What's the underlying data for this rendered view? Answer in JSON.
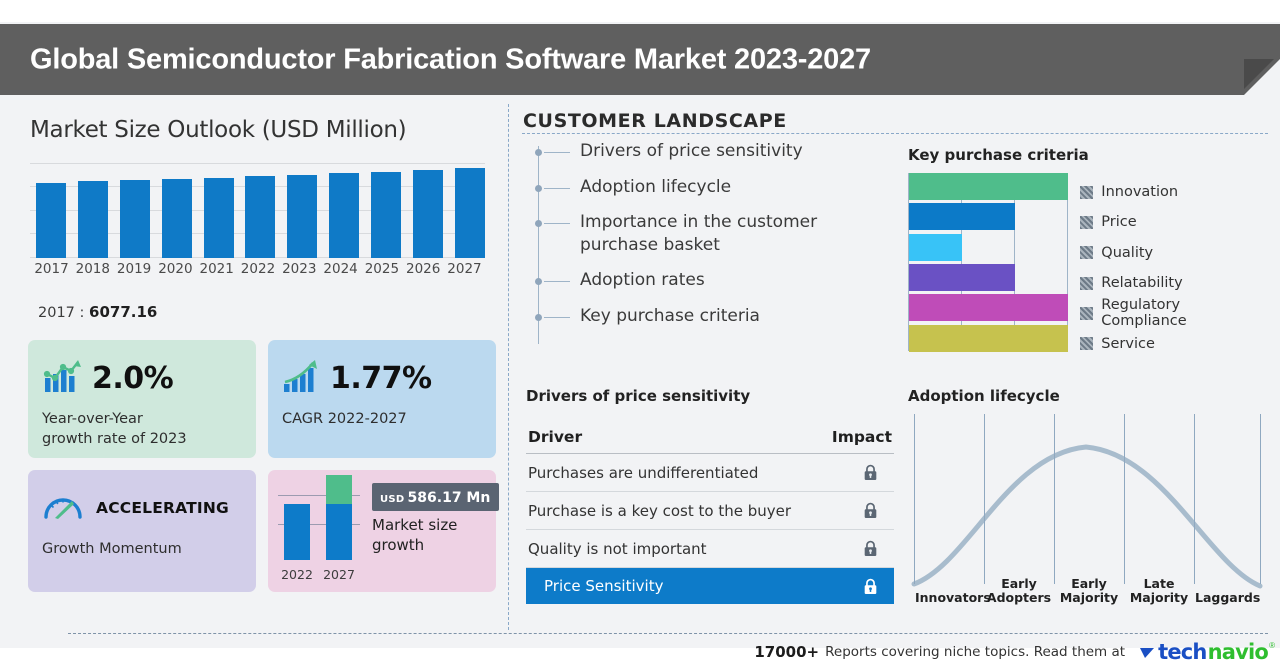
{
  "header": {
    "title": "Global Semiconductor Fabrication Software Market 2023-2027"
  },
  "left": {
    "section_title": "Market Size Outlook (USD Million)",
    "value_note_label": "2017 :",
    "value_note_value": "6077.16",
    "cards": [
      {
        "icon": "bar-chart-growth-icon",
        "big": "2.0%",
        "sub": "Year-over-Year\ngrowth rate of 2023",
        "sub_line1": "Year-over-Year",
        "sub_line2": "growth rate of 2023",
        "color": "#cfe8dc"
      },
      {
        "icon": "ascending-bars-arrow-icon",
        "big": "1.77%",
        "sub_line1": "CAGR  2022-2027",
        "color": "#bbd9ef"
      },
      {
        "icon": "speedometer-icon",
        "label": "ACCELERATING",
        "sub_line1": "Growth Momentum",
        "color": "#d2cee9"
      },
      {
        "icon": "market-growth-bars-icon",
        "badge_currency": "USD",
        "badge_value": "586.17 Mn",
        "text_line1": "Market size",
        "text_line2": "growth",
        "x_labels": [
          "2022",
          "2027"
        ],
        "color": "#eed2e4"
      }
    ]
  },
  "right": {
    "customer_landscape_title": "CUSTOMER LANDSCAPE",
    "landscape_items": [
      "Drivers of price sensitivity",
      "Adoption lifecycle",
      "Importance in the customer purchase basket",
      "Adoption rates",
      "Key purchase criteria"
    ],
    "kpc_title": "Key purchase criteria",
    "drivers_title": "Drivers of price sensitivity",
    "drivers_columns": [
      "Driver",
      "Impact"
    ],
    "drivers_rows": [
      {
        "driver": "Purchases are undifferentiated",
        "impact_icon": "lock-icon",
        "highlighted": false
      },
      {
        "driver": "Purchase is a key cost to the buyer",
        "impact_icon": "lock-icon",
        "highlighted": false
      },
      {
        "driver": "Quality is not important",
        "impact_icon": "lock-icon",
        "highlighted": false
      },
      {
        "driver": "Price Sensitivity",
        "impact_icon": "lock-icon",
        "highlighted": true
      }
    ],
    "adoption_title": "Adoption lifecycle"
  },
  "footer": {
    "count": "17000+",
    "text": "Reports covering niche topics. Read them at",
    "logo_part1": "tech",
    "logo_part2": "navio",
    "logo_tm": "®"
  },
  "colors": {
    "header_bg": "#5f5f5f",
    "canvas_bg": "#f2f3f5",
    "bar_blue": "#0f7ac7",
    "accent_blue": "#0d7bc9",
    "green": "#4fbd8b",
    "brand_blue": "#1a4fc4",
    "brand_green": "#2fbe2f"
  },
  "chart_data": [
    {
      "type": "bar",
      "title": "Market Size Outlook (USD Million)",
      "categories": [
        "2017",
        "2018",
        "2019",
        "2020",
        "2021",
        "2022",
        "2023",
        "2024",
        "2025",
        "2026",
        "2027"
      ],
      "values": [
        6077.16,
        6190,
        6290,
        6380,
        6480,
        6600,
        6720,
        6850,
        6990,
        7120,
        7250
      ],
      "xlabel": "",
      "ylabel": "USD Million",
      "ylim": [
        0,
        7600
      ],
      "grid": true,
      "legend": "none",
      "series_color": "#0f7ac7",
      "annotation": "2017 : 6077.16"
    },
    {
      "type": "bar",
      "title": "Key purchase criteria",
      "orientation": "horizontal",
      "categories": [
        "Innovation",
        "Price",
        "Quality",
        "Relatability",
        "Regulatory Compliance",
        "Service"
      ],
      "values": [
        3,
        2,
        1,
        2,
        3,
        3
      ],
      "xlim": [
        0,
        3
      ],
      "grid": true,
      "legend": "right",
      "colors": [
        "#4fbd8b",
        "#0c7ac8",
        "#38c3f7",
        "#6a51c4",
        "#bf4cb8",
        "#c6c24e"
      ]
    },
    {
      "type": "line",
      "title": "Adoption lifecycle",
      "categories": [
        "Innovators",
        "Early Adopters",
        "Early Majority",
        "Late Majority",
        "Laggards"
      ],
      "x": [
        0,
        1,
        2,
        3,
        4
      ],
      "values": [
        0.08,
        0.55,
        0.98,
        0.62,
        0.02
      ],
      "curve": "bell",
      "xlabel": "",
      "ylabel": "",
      "grid": true,
      "legend": "none",
      "line_color": "#a8bccd"
    },
    {
      "type": "bar",
      "title": "Market size growth",
      "categories": [
        "2022",
        "2027"
      ],
      "values": [
        1,
        1.45
      ],
      "stacked_top": [
        0,
        0.45
      ],
      "annotation": "USD 586.17 Mn",
      "colors": [
        "#0d7bc9",
        "#4fbd8b"
      ],
      "legend": "none"
    }
  ]
}
